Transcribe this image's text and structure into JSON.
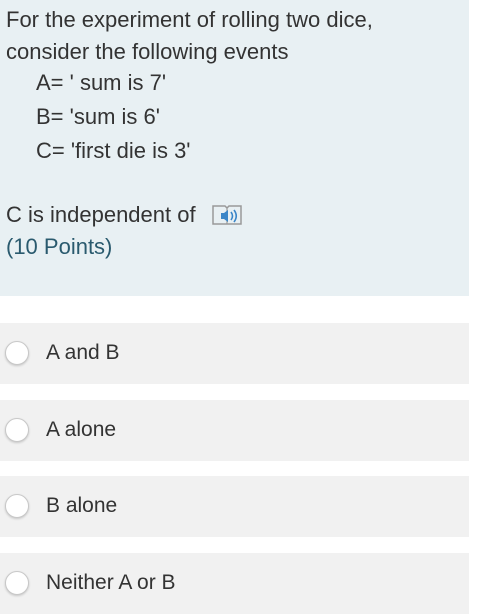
{
  "question": {
    "line1": "For the experiment of rolling two dice,",
    "line2": "consider the following events",
    "events": [
      "A= ' sum is 7'",
      "B= 'sum is 6'",
      "C= 'first die is 3'"
    ],
    "prompt": "C is independent of",
    "points": "(10 Points)",
    "speaker_icon": "immersive-reader-speaker-icon"
  },
  "options": [
    {
      "label": "A and B"
    },
    {
      "label": "A alone"
    },
    {
      "label": "B alone"
    },
    {
      "label": "Neither A or B"
    }
  ],
  "colors": {
    "card_background": "#e8f0f3",
    "option_background": "#f1f1f1",
    "points_text": "#2a5a6e",
    "icon_accent": "#3a86c8"
  }
}
